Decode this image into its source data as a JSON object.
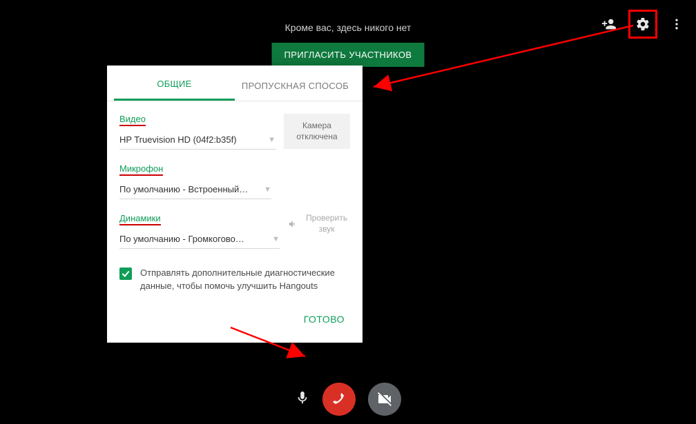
{
  "empty_state_text": "Кроме вас, здесь никого нет",
  "invite_button": "ПРИГЛАСИТЬ УЧАСТНИКОВ",
  "settings": {
    "tabs": {
      "general": "ОБЩИЕ",
      "bandwidth": "ПРОПУСКНАЯ СПОСОБ"
    },
    "video": {
      "label": "Видео",
      "value": "HP Truevision HD (04f2:b35f)",
      "camera_off": "Камера отключена"
    },
    "microphone": {
      "label": "Микрофон",
      "value": "По умолчанию - Встроенный…"
    },
    "speakers": {
      "label": "Динамики",
      "value": "По умолчанию - Громкогово…",
      "test_sound": "Проверить звук"
    },
    "diagnostics_checkbox": "Отправлять дополнительные диагностические данные, чтобы помочь улучшить Hangouts",
    "done": "ГОТОВО"
  },
  "colors": {
    "accent_green": "#0f9d58",
    "annotation_red": "#ff0000",
    "hangup_red": "#d93025",
    "camera_grey": "#5f6368"
  }
}
